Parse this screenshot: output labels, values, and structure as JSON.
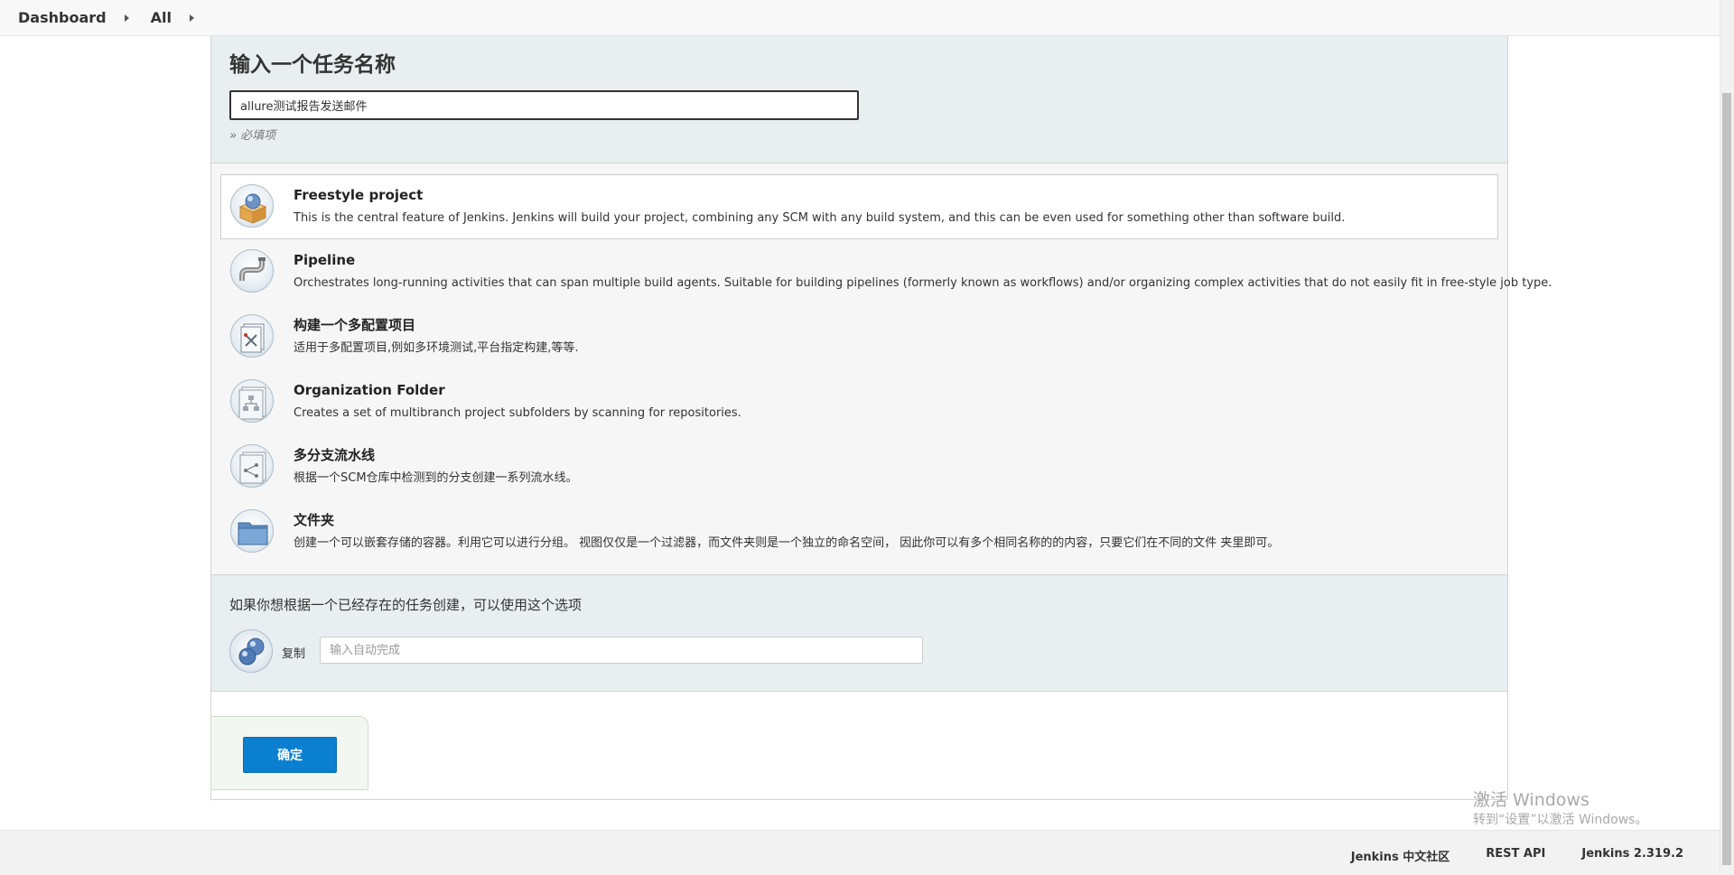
{
  "breadcrumb": {
    "items": [
      {
        "label": "Dashboard"
      },
      {
        "label": "All"
      }
    ]
  },
  "name_section": {
    "title": "输入一个任务名称",
    "value": "allure测试报告发送邮件",
    "required_hint": "» 必填项"
  },
  "item_types": [
    {
      "label": "Freestyle project",
      "description": "This is the central feature of Jenkins. Jenkins will build your project, combining any SCM with any build system, and this can be even used for something other than software build.",
      "icon": "freestyle-project-icon",
      "selected": true
    },
    {
      "label": "Pipeline",
      "description": "Orchestrates long-running activities that can span multiple build agents. Suitable for building pipelines (formerly known as workflows) and/or organizing complex activities that do not easily fit in free-style job type.",
      "icon": "pipeline-icon",
      "selected": false
    },
    {
      "label": "构建一个多配置项目",
      "description": "适用于多配置项目,例如多环境测试,平台指定构建,等等.",
      "icon": "multi-config-project-icon",
      "selected": false
    },
    {
      "label": "Organization Folder",
      "description": "Creates a set of multibranch project subfolders by scanning for repositories.",
      "icon": "organization-folder-icon",
      "selected": false
    },
    {
      "label": "多分支流水线",
      "description": "根据一个SCM仓库中检测到的分支创建一系列流水线。",
      "icon": "multibranch-pipeline-icon",
      "selected": false
    },
    {
      "label": "文件夹",
      "description": "创建一个可以嵌套存储的容器。利用它可以进行分组。 视图仅仅是一个过滤器，而文件夹则是一个独立的命名空间， 因此你可以有多个相同名称的的内容，只要它们在不同的文件 夹里即可。",
      "icon": "folder-icon",
      "selected": false
    }
  ],
  "copy_section": {
    "hint": "如果你想根据一个已经存在的任务创建，可以使用这个选项",
    "label": "复制",
    "placeholder": "输入自动完成"
  },
  "ok_button": {
    "label": "确定"
  },
  "footer": {
    "community": "Jenkins 中文社区",
    "rest_api": "REST API",
    "version": "Jenkins 2.319.2"
  },
  "watermark": {
    "title": "激活 Windows",
    "subtitle": "转到“设置”以激活 Windows。"
  },
  "colors": {
    "accent": "#0b7fd0",
    "panel": "#e9eef1"
  }
}
